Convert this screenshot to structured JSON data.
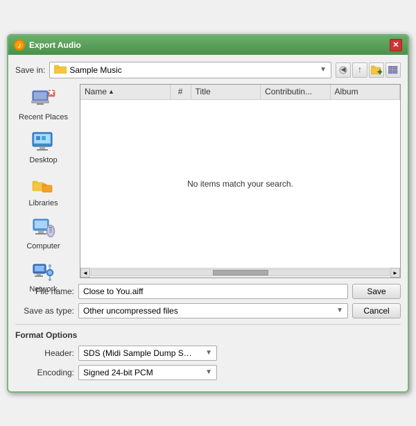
{
  "dialog": {
    "title": "Export Audio",
    "title_icon": "♪",
    "close_label": "✕"
  },
  "toolbar": {
    "save_in_label": "Save in:",
    "folder_name": "Sample Music",
    "back_icon": "◄",
    "up_icon": "▲",
    "new_folder_icon": "📁",
    "views_icon": "▦"
  },
  "sidebar": {
    "items": [
      {
        "id": "recent-places",
        "label": "Recent Places"
      },
      {
        "id": "desktop",
        "label": "Desktop"
      },
      {
        "id": "libraries",
        "label": "Libraries"
      },
      {
        "id": "computer",
        "label": "Computer"
      },
      {
        "id": "network",
        "label": "Network"
      }
    ]
  },
  "file_list": {
    "columns": [
      "Name",
      "#",
      "Title",
      "Contributin...",
      "Album"
    ],
    "empty_message": "No items match your search.",
    "sort_indicator": "▲"
  },
  "form": {
    "filename_label": "File name:",
    "filename_value": "Close to You.aiff",
    "savetype_label": "Save as type:",
    "savetype_value": "Other uncompressed files",
    "save_button": "Save",
    "cancel_button": "Cancel"
  },
  "format_options": {
    "title": "Format Options",
    "header_label": "Header:",
    "header_value": "SDS (Midi Sample Dump Stan",
    "encoding_label": "Encoding:",
    "encoding_value": "Signed 24-bit PCM"
  }
}
